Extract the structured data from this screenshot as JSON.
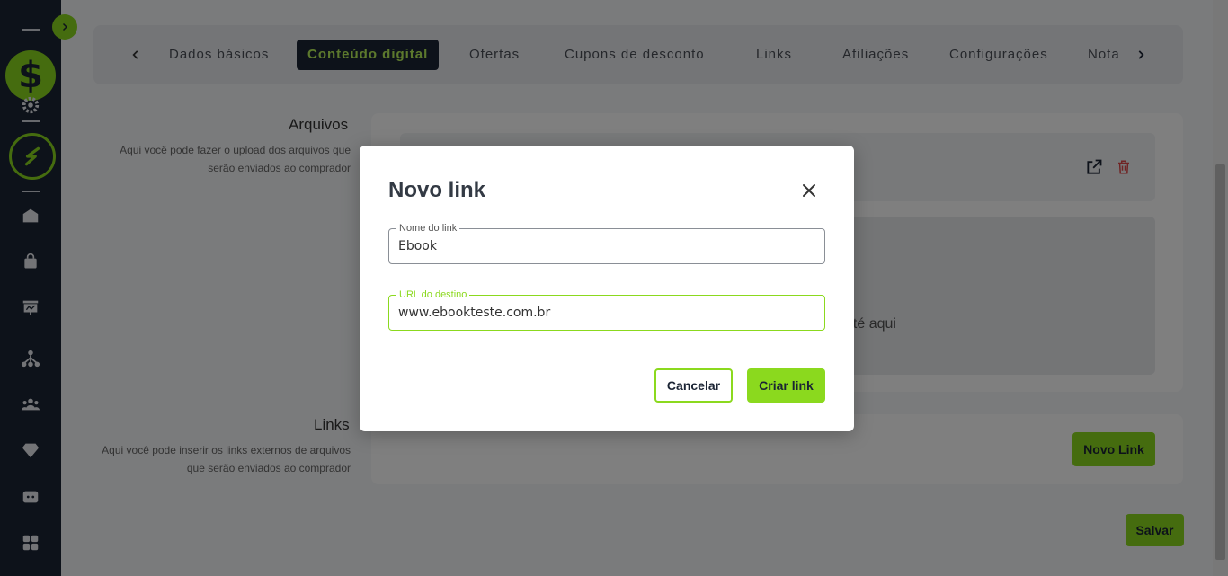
{
  "sidebar": {
    "logo_symbol": "$",
    "icons": [
      "settings-icon",
      "brand-icon",
      "home-icon",
      "shopping-bag-icon",
      "dashboard-icon",
      "network-icon",
      "users-icon",
      "diamond-icon",
      "ticket-icon",
      "apps-icon"
    ]
  },
  "tabs": {
    "items": [
      {
        "label": "Dados básicos"
      },
      {
        "label": "Conteúdo digital"
      },
      {
        "label": "Ofertas"
      },
      {
        "label": "Cupons de desconto"
      },
      {
        "label": "Links"
      },
      {
        "label": "Afiliações"
      },
      {
        "label": "Configurações"
      },
      {
        "label": "Nota"
      }
    ],
    "active": "Conteúdo digital"
  },
  "files_section": {
    "title": "Arquivos",
    "description": "Aqui você pode fazer o upload dos arquivos que serão enviados ao comprador",
    "dropzone_text": "até aqui"
  },
  "links_section": {
    "title": "Links",
    "description": "Aqui você pode inserir os links externos de arquivos que serão enviados ao comprador",
    "new_link_label": "Novo Link"
  },
  "save_label": "Salvar",
  "modal": {
    "title": "Novo link",
    "name_field": {
      "label": "Nome do link",
      "value": "Ebook"
    },
    "url_field": {
      "label": "URL do destino",
      "value": "www.ebookteste.com.br"
    },
    "cancel_label": "Cancelar",
    "create_label": "Criar link"
  },
  "colors": {
    "accent": "#8bd91e",
    "sidebar": "#1b2434",
    "danger": "#e04848"
  }
}
